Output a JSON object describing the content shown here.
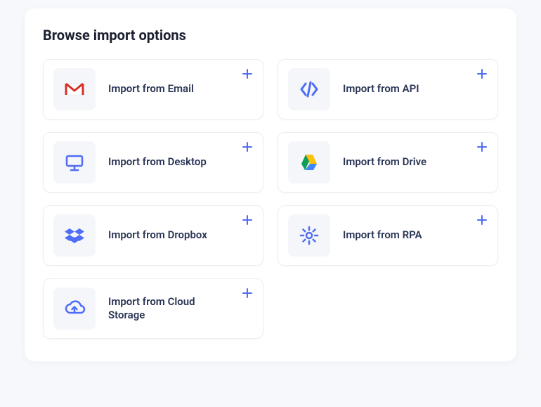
{
  "panel": {
    "title": "Browse import options"
  },
  "options": [
    {
      "label": "Import from Email",
      "icon": "gmail-icon"
    },
    {
      "label": "Import from API",
      "icon": "api-icon"
    },
    {
      "label": "Import from Desktop",
      "icon": "desktop-icon"
    },
    {
      "label": "Import from Drive",
      "icon": "drive-icon"
    },
    {
      "label": "Import from Dropbox",
      "icon": "dropbox-icon"
    },
    {
      "label": "Import from RPA",
      "icon": "gear-icon"
    },
    {
      "label": "Import from Cloud Storage",
      "icon": "cloud-upload-icon"
    }
  ],
  "action": {
    "add": "+"
  }
}
